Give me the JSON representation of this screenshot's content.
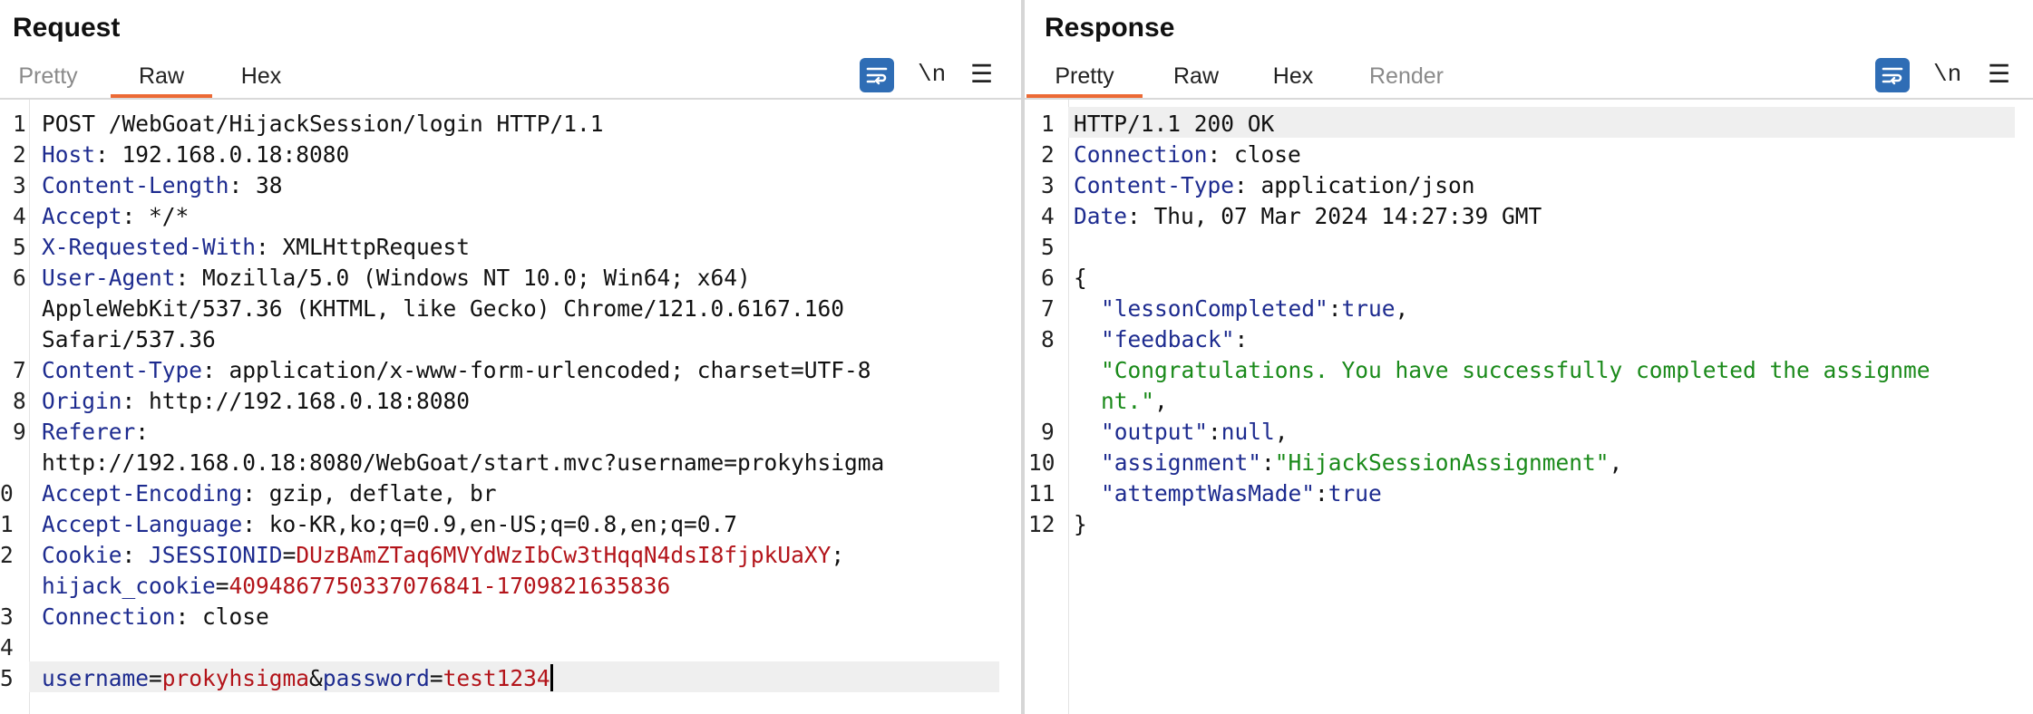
{
  "request": {
    "title": "Request",
    "tabs": [
      {
        "label": "Pretty",
        "state": "inactive"
      },
      {
        "label": "Raw",
        "state": "active"
      },
      {
        "label": "Hex",
        "state": "inactive"
      }
    ],
    "toolbar": {
      "wrap_icon": "wrap-lines-icon",
      "newline_label": "\\n",
      "menu_icon": "hamburger-menu-icon"
    },
    "lines": [
      {
        "n": "1",
        "method_line": "POST /WebGoat/HijackSession/login HTTP/1.1"
      },
      {
        "n": "2",
        "key": "Host",
        "value": " 192.168.0.18:8080"
      },
      {
        "n": "3",
        "key": "Content-Length",
        "value": " 38"
      },
      {
        "n": "4",
        "key": "Accept",
        "value": " */*"
      },
      {
        "n": "5",
        "key": "X-Requested-With",
        "value": " XMLHttpRequest"
      },
      {
        "n": "6",
        "key": "User-Agent",
        "value": " Mozilla/5.0 (Windows NT 10.0; Win64; x64)"
      },
      {
        "n": "",
        "cont": "AppleWebKit/537.36 (KHTML, like Gecko) Chrome/121.0.6167.160"
      },
      {
        "n": "",
        "cont": "Safari/537.36"
      },
      {
        "n": "7",
        "key": "Content-Type",
        "value": " application/x-www-form-urlencoded; charset=UTF-8"
      },
      {
        "n": "8",
        "key": "Origin",
        "value": " http://192.168.0.18:8080"
      },
      {
        "n": "9",
        "key": "Referer",
        "value": ""
      },
      {
        "n": "",
        "cont": "http://192.168.0.18:8080/WebGoat/start.mvc?username=prokyhsigma"
      },
      {
        "n": "0",
        "key": "Accept-Encoding",
        "value": " gzip, deflate, br"
      },
      {
        "n": "1",
        "key": "Accept-Language",
        "value": " ko-KR,ko;q=0.9,en-US;q=0.8,en;q=0.7"
      },
      {
        "n": "2",
        "key": "Cookie",
        "value": " ",
        "cookie1_name": "JSESSIONID",
        "eq": "=",
        "cookie1_value": "DUzBAmZTaq6MVYdWzIbCw3tHqqN4dsI8fjpkUaXY",
        "semi": ";"
      },
      {
        "n": "",
        "cookie2_name": "hijack_cookie",
        "eq": "=",
        "cookie2_value": "4094867750337076841-1709821635836"
      },
      {
        "n": "3",
        "key": "Connection",
        "value": " close"
      },
      {
        "n": "4",
        "blank": ""
      },
      {
        "n": "5",
        "p1_name": "username",
        "eq": "=",
        "p1_value": "prokyhsigma",
        "amp": "&",
        "p2_name": "password",
        "p2_value": "test1234"
      }
    ]
  },
  "response": {
    "title": "Response",
    "tabs": [
      {
        "label": "Pretty",
        "state": "active"
      },
      {
        "label": "Raw",
        "state": "inactive"
      },
      {
        "label": "Hex",
        "state": "inactive"
      },
      {
        "label": "Render",
        "state": "dim"
      }
    ],
    "toolbar": {
      "wrap_icon": "wrap-lines-icon",
      "newline_label": "\\n",
      "menu_icon": "hamburger-menu-icon"
    },
    "lines": [
      {
        "n": "1",
        "status": "HTTP/1.1 200 OK"
      },
      {
        "n": "2",
        "key": "Connection",
        "value": " close"
      },
      {
        "n": "3",
        "key": "Content-Type",
        "value": " application/json"
      },
      {
        "n": "4",
        "key": "Date",
        "value": " Thu, 07 Mar 2024 14:27:39 GMT"
      },
      {
        "n": "5",
        "blank": ""
      },
      {
        "n": "6",
        "brace": "{"
      },
      {
        "n": "7",
        "jkey": "\"lessonCompleted\"",
        "colon": ":",
        "jlit": "true",
        "comma": ","
      },
      {
        "n": "8",
        "jkey": "\"feedback\"",
        "colon": ":"
      },
      {
        "n": "",
        "jstr": "\"Congratulations. You have successfully completed the assignme"
      },
      {
        "n": "",
        "jstr": "nt.\"",
        "comma": ","
      },
      {
        "n": "9",
        "jkey": "\"output\"",
        "colon": ":",
        "jlit": "null",
        "comma": ","
      },
      {
        "n": "10",
        "jkey": "\"assignment\"",
        "colon": ":",
        "jstrv": "\"HijackSessionAssignment\"",
        "comma": ","
      },
      {
        "n": "11",
        "jkey": "\"attemptWasMade\"",
        "colon": ":",
        "jlit": "true"
      },
      {
        "n": "12",
        "brace": "}"
      }
    ]
  }
}
